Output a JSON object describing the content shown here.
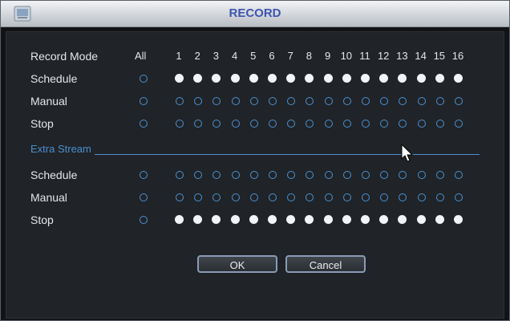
{
  "window": {
    "title": "RECORD"
  },
  "grid": {
    "channels": [
      "1",
      "2",
      "3",
      "4",
      "5",
      "6",
      "7",
      "8",
      "9",
      "10",
      "11",
      "12",
      "13",
      "14",
      "15",
      "16"
    ],
    "all_header": "All",
    "main_stream": {
      "header_label": "Record Mode",
      "rows": [
        {
          "label": "Schedule",
          "all": false,
          "states": [
            true,
            true,
            true,
            true,
            true,
            true,
            true,
            true,
            true,
            true,
            true,
            true,
            true,
            true,
            true,
            true
          ]
        },
        {
          "label": "Manual",
          "all": false,
          "states": [
            false,
            false,
            false,
            false,
            false,
            false,
            false,
            false,
            false,
            false,
            false,
            false,
            false,
            false,
            false,
            false
          ]
        },
        {
          "label": "Stop",
          "all": false,
          "states": [
            false,
            false,
            false,
            false,
            false,
            false,
            false,
            false,
            false,
            false,
            false,
            false,
            false,
            false,
            false,
            false
          ]
        }
      ]
    },
    "extra_stream": {
      "section_label": "Extra Stream",
      "rows": [
        {
          "label": "Schedule",
          "all": false,
          "states": [
            false,
            false,
            false,
            false,
            false,
            false,
            false,
            false,
            false,
            false,
            false,
            false,
            false,
            false,
            false,
            false
          ]
        },
        {
          "label": "Manual",
          "all": false,
          "states": [
            false,
            false,
            false,
            false,
            false,
            false,
            false,
            false,
            false,
            false,
            false,
            false,
            false,
            false,
            false,
            false
          ]
        },
        {
          "label": "Stop",
          "all": false,
          "states": [
            true,
            true,
            true,
            true,
            true,
            true,
            true,
            true,
            true,
            true,
            true,
            true,
            true,
            true,
            true,
            true
          ]
        }
      ]
    }
  },
  "buttons": {
    "ok_label": "OK",
    "cancel_label": "Cancel"
  },
  "colors": {
    "accent": "#4b8fd0",
    "title_text": "#3d55b0",
    "selected_dot": "#f2f4f7"
  }
}
